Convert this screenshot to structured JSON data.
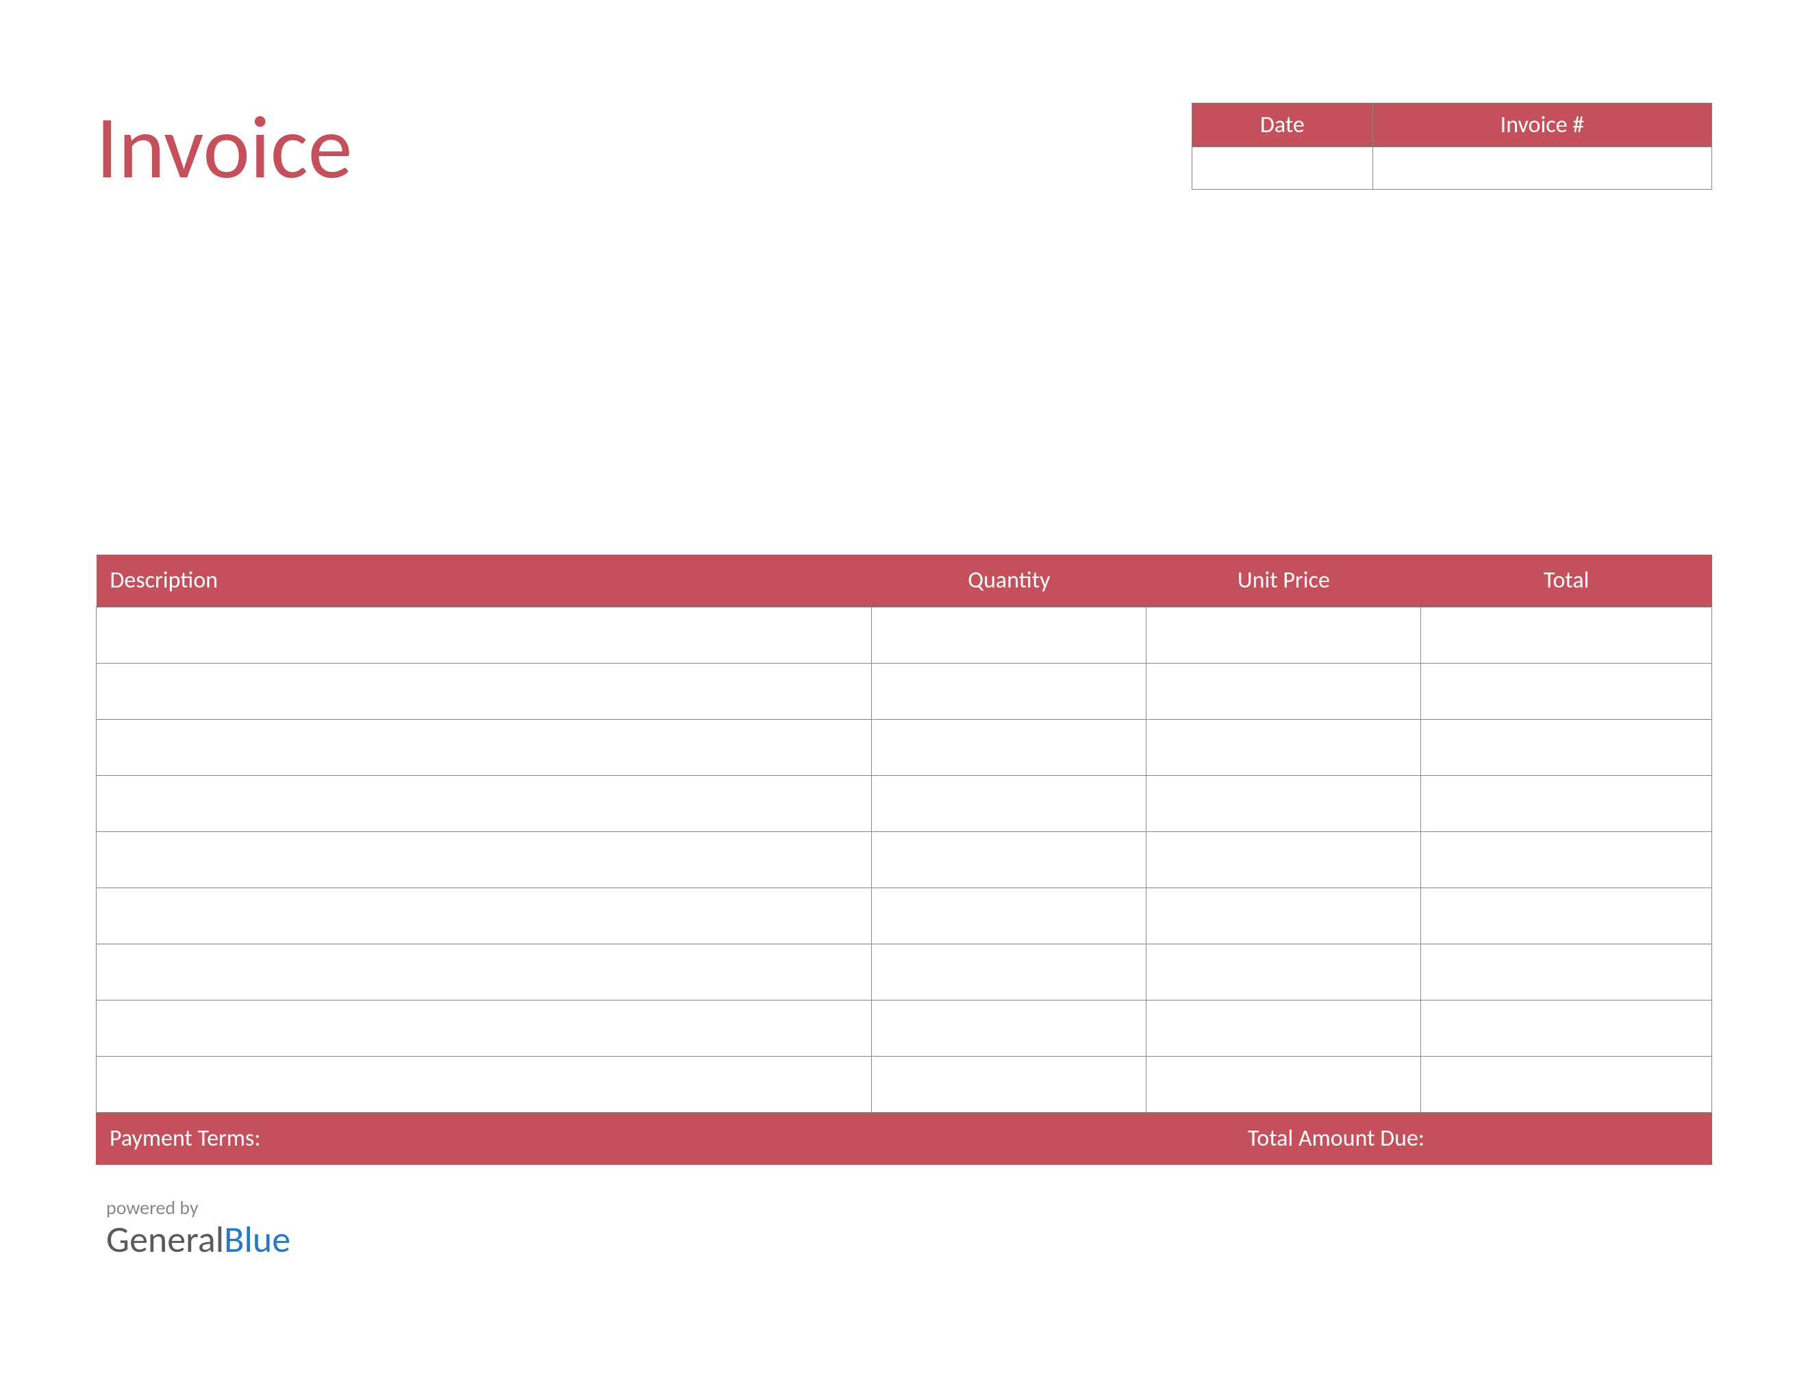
{
  "title": "Invoice",
  "meta": {
    "date_label": "Date",
    "invoice_num_label": "Invoice #",
    "date_value": "",
    "invoice_num_value": ""
  },
  "columns": {
    "description": "Description",
    "quantity": "Quantity",
    "unit_price": "Unit Price",
    "total": "Total"
  },
  "rows": [
    {
      "description": "",
      "quantity": "",
      "unit_price": "",
      "total": ""
    },
    {
      "description": "",
      "quantity": "",
      "unit_price": "",
      "total": ""
    },
    {
      "description": "",
      "quantity": "",
      "unit_price": "",
      "total": ""
    },
    {
      "description": "",
      "quantity": "",
      "unit_price": "",
      "total": ""
    },
    {
      "description": "",
      "quantity": "",
      "unit_price": "",
      "total": ""
    },
    {
      "description": "",
      "quantity": "",
      "unit_price": "",
      "total": ""
    },
    {
      "description": "",
      "quantity": "",
      "unit_price": "",
      "total": ""
    },
    {
      "description": "",
      "quantity": "",
      "unit_price": "",
      "total": ""
    },
    {
      "description": "",
      "quantity": "",
      "unit_price": "",
      "total": ""
    }
  ],
  "footer": {
    "payment_terms_label": "Payment Terms:",
    "total_due_label": "Total Amount Due:"
  },
  "branding": {
    "powered_by": "powered by",
    "brand_first": "General",
    "brand_second": "Blue"
  }
}
